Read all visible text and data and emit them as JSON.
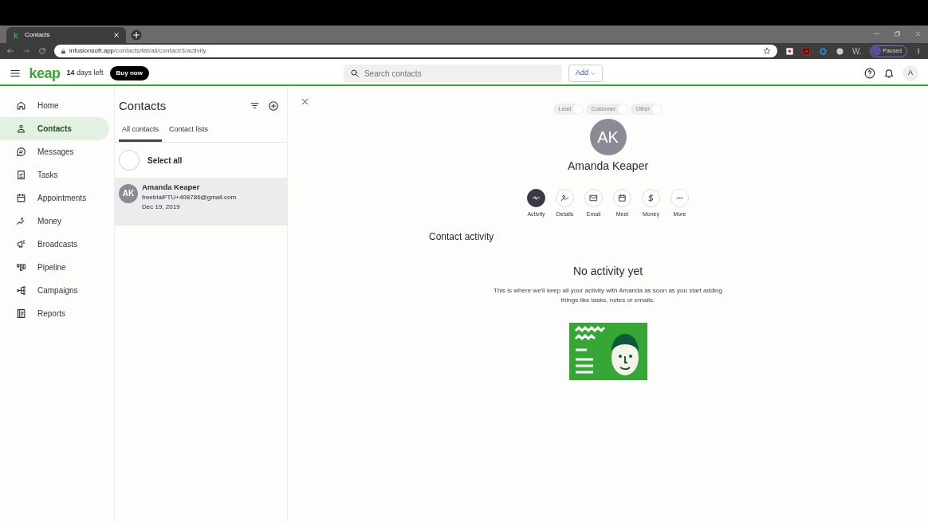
{
  "browser": {
    "tab": {
      "title": "Contacts"
    },
    "url_host": "infusionsoft.app",
    "url_path": "/contacts/list/all/contact/3/activity",
    "extension_label": "W.",
    "profile": "Paused"
  },
  "header": {
    "logo": "keap",
    "trial": {
      "days": "14",
      "text": "days left"
    },
    "buy_button": "Buy now",
    "search": {
      "placeholder": "Search contacts"
    },
    "add_button": "Add",
    "user_initial": "A"
  },
  "sidebar": {
    "items": [
      {
        "label": "Home",
        "selected": false
      },
      {
        "label": "Contacts",
        "selected": true
      },
      {
        "label": "Messages",
        "selected": false
      },
      {
        "label": "Tasks",
        "selected": false
      },
      {
        "label": "Appointments",
        "selected": false
      },
      {
        "label": "Money",
        "selected": false
      },
      {
        "label": "Broadcasts",
        "selected": false
      },
      {
        "label": "Pipeline",
        "selected": false
      },
      {
        "label": "Campaigns",
        "selected": false
      },
      {
        "label": "Reports",
        "selected": false
      }
    ]
  },
  "contacts_panel": {
    "title": "Contacts",
    "tabs": [
      {
        "label": "All contacts",
        "selected": true
      },
      {
        "label": "Contact lists",
        "selected": false
      }
    ],
    "select_all": {
      "label": "Select all",
      "checked": false
    },
    "contacts": [
      {
        "initials": "AK",
        "name": "Amanda Keaper",
        "email": "freetrialFTU+408786@gmail.com",
        "date": "Dec 19, 2019",
        "selected": true
      }
    ]
  },
  "contact": {
    "types": [
      {
        "label": "Lead",
        "on": false
      },
      {
        "label": "Customer",
        "on": false
      },
      {
        "label": "Other",
        "on": false
      }
    ],
    "initials": "AK",
    "name": "Amanda Keaper",
    "actions": [
      {
        "label": "Activity",
        "selected": true
      },
      {
        "label": "Details",
        "selected": false
      },
      {
        "label": "Email",
        "selected": false
      },
      {
        "label": "Meet",
        "selected": false
      },
      {
        "label": "Money",
        "selected": false
      },
      {
        "label": "More",
        "selected": false
      }
    ],
    "section_title": "Contact activity",
    "empty_title": "No activity yet",
    "empty_text": "This is where we'll keep all your activity with Amanda as soon as you start adding things like tasks, notes or emails."
  }
}
